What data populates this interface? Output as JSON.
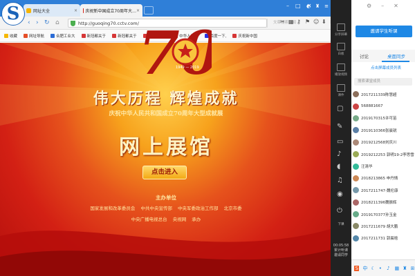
{
  "browser": {
    "logo_letter": "S",
    "tabs": [
      {
        "label": "网址大全",
        "close": "×"
      },
      {
        "label": "庆祝新中国成立70周年大…",
        "close": "×"
      }
    ],
    "nav": {
      "back": "‹",
      "forward": "›",
      "refresh": "↻"
    },
    "url": "http://guoqing70.cctv.com/",
    "search_placeholder": "文章搜索新闻",
    "window_controls": [
      "–",
      "□",
      "✕"
    ],
    "bookmarks": [
      "收藏",
      "网址导航",
      "合肥工业大",
      "新冠都关于",
      "新冠都关于",
      "新冠都关于",
      "中华人民共",
      "百度一下,",
      "庆祝新中国"
    ],
    "bookmark_colors": [
      "#f5b700",
      "#e54d26",
      "#2b6cd6",
      "#d63636",
      "#d63636",
      "#d63636",
      "#c8102e",
      "#2932e1",
      "#d63636"
    ]
  },
  "page": {
    "emblem_number": "70",
    "emblem_years": "1949 — 2019",
    "headline": "伟大历程  辉煌成就",
    "subheadline": "庆祝中华人民共和国成立70周年大型成就展",
    "exhibition": "网上展馆",
    "enter_button": "点击进入",
    "host_label": "主办单位",
    "organizers_line1": "国家发展和改革委员会  中共中央宣传部  中央军委政治工作部  北京市委",
    "organizers_line2": "中央广播电视总台  央视网  承办"
  },
  "panel": {
    "sidebar_items": [
      "分享屏幕",
      "白板",
      "播放视频",
      "课件"
    ],
    "student_button": "邀请学生听课",
    "tabs": {
      "discuss": "讨论",
      "desktop": "桌面同步"
    },
    "list_header": "点击屏幕成员列表",
    "search_placeholder": "搜索课堂成员",
    "members": [
      "2017211339陈慧超",
      "568881667",
      "2019170315许可苗",
      "2019110366张晨锐",
      "2019212568刘庆川",
      "2019212253 郭明19-2李思雪",
      "汪清华",
      "2018213865 申丹情",
      "2017211747-魏伦康",
      "2018211396魏振辉",
      "2019170377孙玉金",
      "2017211679 胡大鹏",
      "2017211731 郭晨晗"
    ],
    "member_colors": [
      "#8a6d5a",
      "#c44",
      "#7a8",
      "#5b7fa6",
      "#a87",
      "#9a5",
      "#3b9",
      "#c85",
      "#79a",
      "#a66",
      "#6a8",
      "#886",
      "#58a"
    ],
    "download_label": "下课",
    "timer": "00:05:58",
    "timer_label": "累计听课",
    "share_label": "邀请同学"
  }
}
